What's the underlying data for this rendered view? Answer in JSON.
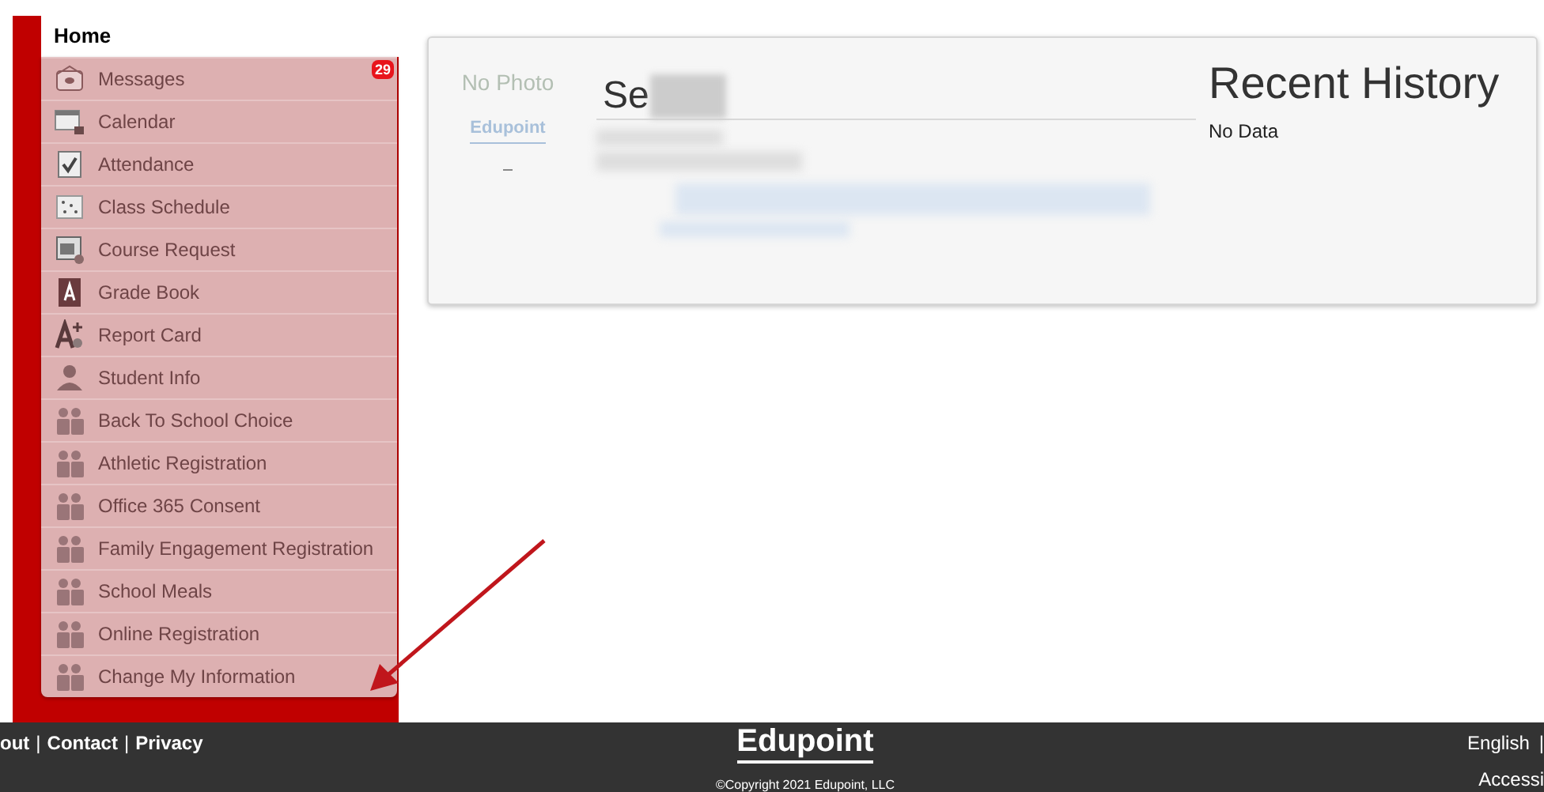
{
  "nav": {
    "home": "Home",
    "items": [
      {
        "label": "Messages",
        "kind": "envelope",
        "badge": "29"
      },
      {
        "label": "Calendar",
        "kind": "calendar"
      },
      {
        "label": "Attendance",
        "kind": "checklist"
      },
      {
        "label": "Class Schedule",
        "kind": "schedule"
      },
      {
        "label": "Course Request",
        "kind": "course"
      },
      {
        "label": "Grade Book",
        "kind": "gradebook"
      },
      {
        "label": "Report Card",
        "kind": "reportcard"
      },
      {
        "label": "Student Info",
        "kind": "person"
      },
      {
        "label": "Back To School Choice",
        "kind": "people"
      },
      {
        "label": "Athletic Registration",
        "kind": "people"
      },
      {
        "label": "Office 365 Consent",
        "kind": "people"
      },
      {
        "label": "Family Engagement Registration",
        "kind": "people"
      },
      {
        "label": "School Meals",
        "kind": "people"
      },
      {
        "label": "Online Registration",
        "kind": "people"
      },
      {
        "label": "Change My Information",
        "kind": "people"
      }
    ]
  },
  "student_card": {
    "photo": "No Photo",
    "logo": "Edupoint",
    "name": "Se",
    "history_title": "Recent History",
    "history_text": "No Data"
  },
  "footer": {
    "links": [
      {
        "label": "out"
      },
      {
        "separator": "|",
        "label": "Contact"
      },
      {
        "separator": "|",
        "label": "Privacy"
      }
    ],
    "logo": "Edupoint",
    "copyright": "©Copyright 2021 Edupoint, LLC",
    "language": "English",
    "language_separator": "|",
    "accessibility": "Accessi"
  }
}
